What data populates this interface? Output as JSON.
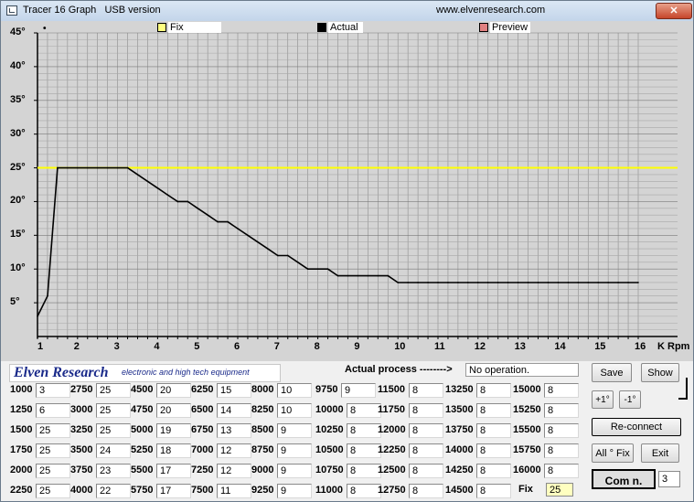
{
  "window": {
    "title": "Tracer 16 Graph   USB version",
    "url": "www.elvenresearch.com",
    "close_label": "✕"
  },
  "chart_data": {
    "type": "line",
    "x_unit": "K Rpm",
    "x_ticks": [
      "1",
      "2",
      "3",
      "4",
      "5",
      "6",
      "7",
      "8",
      "9",
      "10",
      "11",
      "12",
      "13",
      "14",
      "15",
      "16"
    ],
    "y_ticks": [
      "5°",
      "10°",
      "15°",
      "20°",
      "25°",
      "30°",
      "35°",
      "40°",
      "45°"
    ],
    "xlim": [
      1,
      16
    ],
    "ylim": [
      0,
      45
    ],
    "grid": true,
    "legend_position": "top",
    "fix_value": 25,
    "colors": {
      "fix": "#ffff00",
      "actual": "#000000",
      "preview": "#e08080"
    },
    "series": [
      {
        "name": "Actual",
        "x": [
          1.0,
          1.25,
          1.5,
          1.75,
          2.0,
          2.25,
          2.5,
          2.75,
          3.0,
          3.25,
          3.5,
          3.75,
          4.0,
          4.25,
          4.5,
          4.75,
          5.0,
          5.25,
          5.5,
          5.75,
          6.0,
          6.25,
          6.5,
          6.75,
          7.0,
          7.25,
          7.5,
          7.75,
          8.0,
          8.25,
          8.5,
          8.75,
          9.0,
          9.25,
          9.5,
          9.75,
          10.0,
          10.25,
          10.5,
          10.75,
          11.0,
          11.25,
          11.5,
          11.75,
          12.0,
          12.25,
          12.5,
          12.75,
          13.0,
          13.25,
          13.5,
          13.75,
          14.0,
          14.25,
          14.5,
          14.75,
          15.0,
          15.25,
          15.5,
          15.75,
          16.0
        ],
        "y": [
          3,
          6,
          25,
          25,
          25,
          25,
          25,
          25,
          25,
          25,
          24,
          23,
          22,
          21,
          20,
          20,
          19,
          18,
          17,
          17,
          16,
          15,
          14,
          13,
          12,
          12,
          11,
          10,
          10,
          10,
          9,
          9,
          9,
          9,
          9,
          9,
          8,
          8,
          8,
          8,
          8,
          8,
          8,
          8,
          8,
          8,
          8,
          8,
          8,
          8,
          8,
          8,
          8,
          8,
          8,
          8,
          8,
          8,
          8,
          8,
          8
        ]
      }
    ]
  },
  "legend": {
    "origin_mark": "•",
    "fix": "Fix",
    "actual": "Actual",
    "preview": "Preview"
  },
  "panel": {
    "brand_name": "Elven Research",
    "brand_tag": "electronic and high tech equipment",
    "actual_process_label": "Actual process -------->",
    "status": "No operation.",
    "table": [
      [
        {
          "rpm": "1000",
          "deg": "3"
        },
        {
          "rpm": "1250",
          "deg": "6"
        },
        {
          "rpm": "1500",
          "deg": "25"
        },
        {
          "rpm": "1750",
          "deg": "25"
        },
        {
          "rpm": "2000",
          "deg": "25"
        },
        {
          "rpm": "2250",
          "deg": "25"
        }
      ],
      [
        {
          "rpm": "2750",
          "deg": "25"
        },
        {
          "rpm": "3000",
          "deg": "25"
        },
        {
          "rpm": "3250",
          "deg": "25"
        },
        {
          "rpm": "3500",
          "deg": "24"
        },
        {
          "rpm": "3750",
          "deg": "23"
        },
        {
          "rpm": "4000",
          "deg": "22"
        }
      ],
      [
        {
          "rpm": "4500",
          "deg": "20"
        },
        {
          "rpm": "4750",
          "deg": "20"
        },
        {
          "rpm": "5000",
          "deg": "19"
        },
        {
          "rpm": "5250",
          "deg": "18"
        },
        {
          "rpm": "5500",
          "deg": "17"
        },
        {
          "rpm": "5750",
          "deg": "17"
        }
      ],
      [
        {
          "rpm": "6250",
          "deg": "15"
        },
        {
          "rpm": "6500",
          "deg": "14"
        },
        {
          "rpm": "6750",
          "deg": "13"
        },
        {
          "rpm": "7000",
          "deg": "12"
        },
        {
          "rpm": "7250",
          "deg": "12"
        },
        {
          "rpm": "7500",
          "deg": "11"
        }
      ],
      [
        {
          "rpm": "8000",
          "deg": "10"
        },
        {
          "rpm": "8250",
          "deg": "10"
        },
        {
          "rpm": "8500",
          "deg": "9"
        },
        {
          "rpm": "8750",
          "deg": "9"
        },
        {
          "rpm": "9000",
          "deg": "9"
        },
        {
          "rpm": "9250",
          "deg": "9"
        }
      ],
      [
        {
          "rpm": "9750",
          "deg": "9"
        },
        {
          "rpm": "10000",
          "deg": "8"
        },
        {
          "rpm": "10250",
          "deg": "8"
        },
        {
          "rpm": "10500",
          "deg": "8"
        },
        {
          "rpm": "10750",
          "deg": "8"
        },
        {
          "rpm": "11000",
          "deg": "8"
        }
      ],
      [
        {
          "rpm": "11500",
          "deg": "8"
        },
        {
          "rpm": "11750",
          "deg": "8"
        },
        {
          "rpm": "12000",
          "deg": "8"
        },
        {
          "rpm": "12250",
          "deg": "8"
        },
        {
          "rpm": "12500",
          "deg": "8"
        },
        {
          "rpm": "12750",
          "deg": "8"
        }
      ],
      [
        {
          "rpm": "13250",
          "deg": "8"
        },
        {
          "rpm": "13500",
          "deg": "8"
        },
        {
          "rpm": "13750",
          "deg": "8"
        },
        {
          "rpm": "14000",
          "deg": "8"
        },
        {
          "rpm": "14250",
          "deg": "8"
        },
        {
          "rpm": "14500",
          "deg": "8"
        }
      ],
      [
        {
          "rpm": "15000",
          "deg": "8"
        },
        {
          "rpm": "15250",
          "deg": "8"
        },
        {
          "rpm": "15500",
          "deg": "8"
        },
        {
          "rpm": "15750",
          "deg": "8"
        },
        {
          "rpm": "16000",
          "deg": "8"
        }
      ]
    ],
    "fix_label": "Fix",
    "fix_value": "25",
    "buttons": {
      "save": "Save",
      "show": "Show",
      "plus": "+1°",
      "minus": "-1°",
      "reconnect": "Re-connect",
      "all_fix": "All ° Fix",
      "exit": "Exit"
    },
    "com_label": "Com n.",
    "com_value": "3"
  }
}
